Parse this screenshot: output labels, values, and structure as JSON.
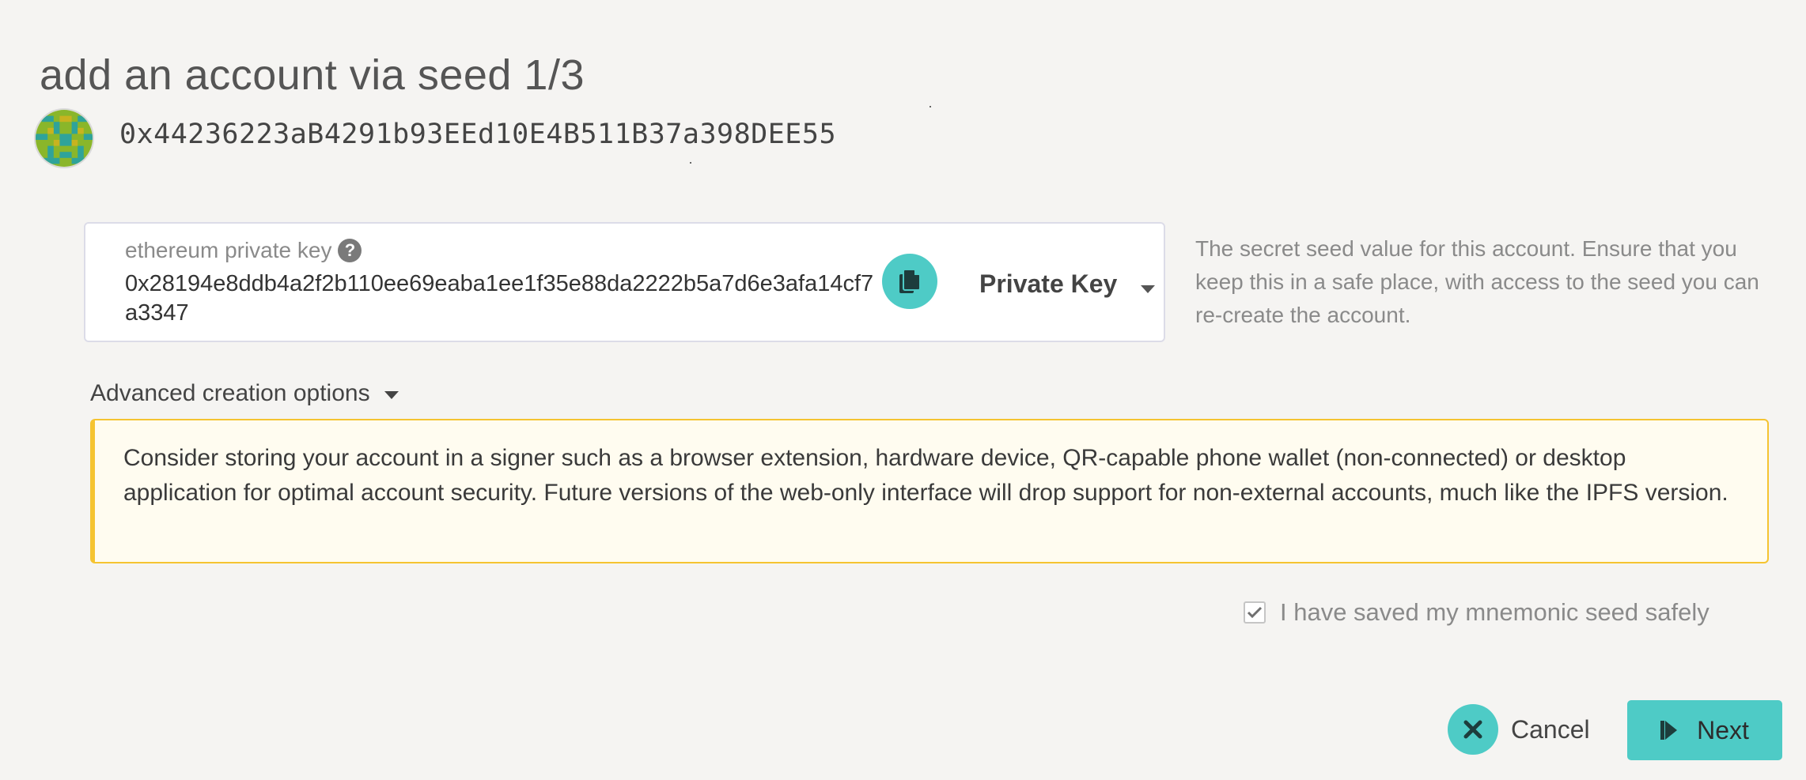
{
  "page": {
    "title": "add an account via seed 1/3"
  },
  "account": {
    "address": "0x44236223aB4291b93EEd10E4B511B37a398DEE55"
  },
  "seed": {
    "label": "ethereum private key",
    "value": "0x28194e8ddb4a2f2b110ee69eaba1ee1f35e88da2222b5a7d6e3afa14cf7a3347",
    "type_selected": "Private Key",
    "help_text": "The secret seed value for this account. Ensure that you keep this in a safe place, with access to the seed you can re-create the account."
  },
  "advanced": {
    "label": "Advanced creation options"
  },
  "warning": {
    "text": "Consider storing your account in a signer such as a browser extension, hardware device, QR-capable phone wallet (non-connected) or desktop application for optimal account security. Future versions of the web-only interface will drop support for non-external accounts, much like the IPFS version."
  },
  "confirm": {
    "label": "I have saved my mnemonic seed safely",
    "checked": true
  },
  "actions": {
    "cancel_label": "Cancel",
    "next_label": "Next"
  },
  "icons": {
    "identicon": "identicon-icon",
    "help": "question-circle-icon",
    "copy": "copy-icon",
    "dropdown": "caret-down-icon",
    "check": "check-icon",
    "cancel": "close-icon",
    "next": "step-forward-icon"
  },
  "colors": {
    "accent": "#4ecbc6",
    "warning_border": "#f5c431",
    "warning_background": "#fffcf0"
  }
}
